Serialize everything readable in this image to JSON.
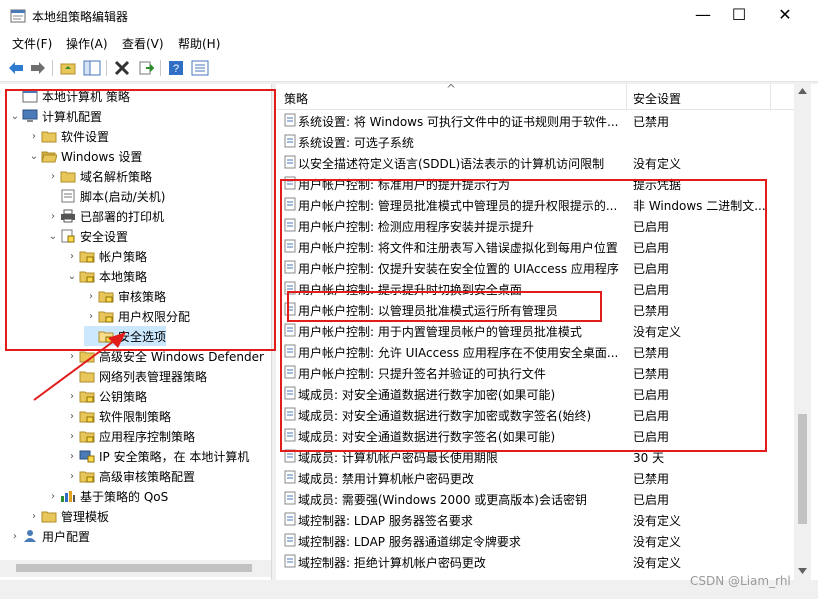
{
  "window": {
    "title": "本地组策略编辑器",
    "minimize": "—",
    "maximize": "☐",
    "close": "✕"
  },
  "menu": [
    "文件(F)",
    "操作(A)",
    "查看(V)",
    "帮助(H)"
  ],
  "toolbar": [
    "back-arrow-icon",
    "forward-arrow-icon",
    "up-folder-icon",
    "show-tree-icon",
    "delete-icon",
    "export-icon",
    "help-icon",
    "properties-icon"
  ],
  "tree": [
    {
      "label": "本地计算机 策略",
      "level": 0,
      "expander": "",
      "icon": "policy"
    },
    {
      "label": "计算机配置",
      "level": 0,
      "expander": "⌄",
      "icon": "computer"
    },
    {
      "label": "软件设置",
      "level": 1,
      "expander": "›",
      "icon": "folder"
    },
    {
      "label": "Windows 设置",
      "level": 1,
      "expander": "⌄",
      "icon": "folder-open"
    },
    {
      "label": "域名解析策略",
      "level": 2,
      "expander": "›",
      "icon": "folder"
    },
    {
      "label": "脚本(启动/关机)",
      "level": 2,
      "expander": "",
      "icon": "script"
    },
    {
      "label": "已部署的打印机",
      "level": 2,
      "expander": "›",
      "icon": "printer"
    },
    {
      "label": "安全设置",
      "level": 2,
      "expander": "⌄",
      "icon": "security"
    },
    {
      "label": "帐户策略",
      "level": 3,
      "expander": "›",
      "icon": "folder-lock"
    },
    {
      "label": "本地策略",
      "level": 3,
      "expander": "⌄",
      "icon": "folder-lock"
    },
    {
      "label": "审核策略",
      "level": 4,
      "expander": "›",
      "icon": "folder-lock"
    },
    {
      "label": "用户权限分配",
      "level": 4,
      "expander": "›",
      "icon": "folder-lock"
    },
    {
      "label": "安全选项",
      "level": 4,
      "expander": "",
      "icon": "folder-lock-open"
    },
    {
      "label": "高级安全 Windows Defender",
      "level": 3,
      "expander": "›",
      "icon": "folder"
    },
    {
      "label": "网络列表管理器策略",
      "level": 3,
      "expander": "",
      "icon": "folder"
    },
    {
      "label": "公钥策略",
      "level": 3,
      "expander": "›",
      "icon": "folder-lock"
    },
    {
      "label": "软件限制策略",
      "level": 3,
      "expander": "›",
      "icon": "folder-lock"
    },
    {
      "label": "应用程序控制策略",
      "level": 3,
      "expander": "›",
      "icon": "folder-lock"
    },
    {
      "label": "IP 安全策略，在 本地计算机",
      "level": 3,
      "expander": "›",
      "icon": "ip-security"
    },
    {
      "label": "高级审核策略配置",
      "level": 3,
      "expander": "›",
      "icon": "folder-lock"
    },
    {
      "label": "基于策略的 QoS",
      "level": 2,
      "expander": "›",
      "icon": "chart"
    },
    {
      "label": "管理模板",
      "level": 1,
      "expander": "›",
      "icon": "folder"
    },
    {
      "label": "用户配置",
      "level": 0,
      "expander": "›",
      "icon": "user"
    }
  ],
  "columns": {
    "policy": "策略",
    "setting": "安全设置",
    "sort_arrow": "^"
  },
  "rows": [
    {
      "policy": "系统设置: 将 Windows 可执行文件中的证书规则用于软件...",
      "setting": "已禁用"
    },
    {
      "policy": "系统设置: 可选子系统",
      "setting": ""
    },
    {
      "policy": "以安全描述符定义语言(SDDL)语法表示的计算机访问限制",
      "setting": "没有定义"
    },
    {
      "policy": "用户帐户控制: 标准用户的提升提示行为",
      "setting": "提示凭据"
    },
    {
      "policy": "用户帐户控制: 管理员批准模式中管理员的提升权限提示的...",
      "setting": "非 Windows 二进制文..."
    },
    {
      "policy": "用户帐户控制: 检测应用程序安装并提示提升",
      "setting": "已启用"
    },
    {
      "policy": "用户帐户控制: 将文件和注册表写入错误虚拟化到每用户位置",
      "setting": "已启用"
    },
    {
      "policy": "用户帐户控制: 仅提升安装在安全位置的 UIAccess 应用程序",
      "setting": "已启用"
    },
    {
      "policy": "用户帐户控制: 提示提升时切换到安全桌面",
      "setting": "已启用"
    },
    {
      "policy": "用户帐户控制: 以管理员批准模式运行所有管理员",
      "setting": "已禁用"
    },
    {
      "policy": "用户帐户控制: 用于内置管理员帐户的管理员批准模式",
      "setting": "没有定义"
    },
    {
      "policy": "用户帐户控制: 允许 UIAccess 应用程序在不使用安全桌面...",
      "setting": "已禁用"
    },
    {
      "policy": "用户帐户控制: 只提升签名并验证的可执行文件",
      "setting": "已禁用"
    },
    {
      "policy": "域成员: 对安全通道数据进行数字加密(如果可能)",
      "setting": "已启用"
    },
    {
      "policy": "域成员: 对安全通道数据进行数字加密或数字签名(始终)",
      "setting": "已启用"
    },
    {
      "policy": "域成员: 对安全通道数据进行数字签名(如果可能)",
      "setting": "已启用"
    },
    {
      "policy": "域成员: 计算机帐户密码最长使用期限",
      "setting": "30 天"
    },
    {
      "policy": "域成员: 禁用计算机帐户密码更改",
      "setting": "已禁用"
    },
    {
      "policy": "域成员: 需要强(Windows 2000 或更高版本)会话密钥",
      "setting": "已启用"
    },
    {
      "policy": "域控制器: LDAP 服务器签名要求",
      "setting": "没有定义"
    },
    {
      "policy": "域控制器: LDAP 服务器通道绑定令牌要求",
      "setting": "没有定义"
    },
    {
      "policy": "域控制器: 拒绝计算机帐户密码更改",
      "setting": "没有定义"
    }
  ],
  "watermark": "CSDN @Liam_rhl",
  "colors": {
    "highlight": "#e21b1b",
    "folder": "#e8c65a"
  }
}
